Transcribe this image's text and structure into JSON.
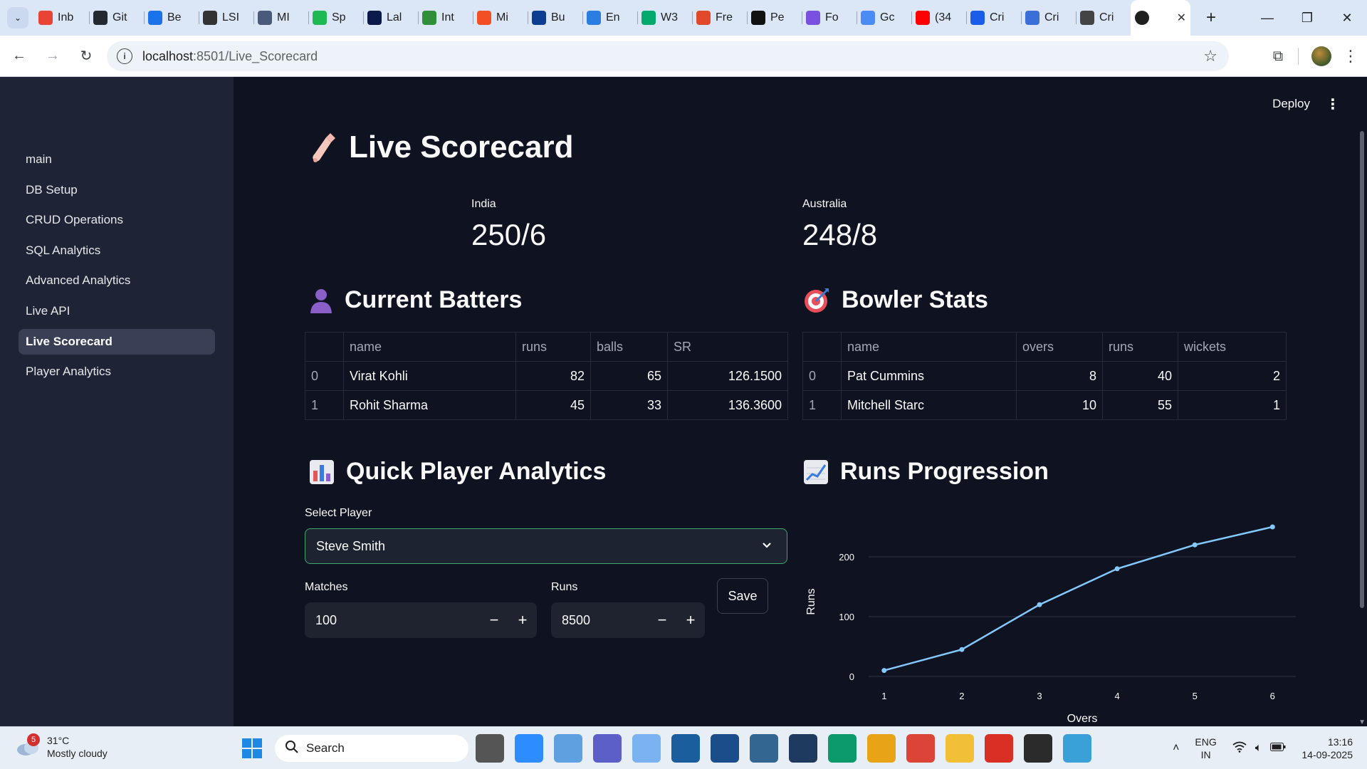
{
  "browser": {
    "tabs": [
      {
        "label": "Inb",
        "color": "#ea4335"
      },
      {
        "label": "Git",
        "color": "#24292f"
      },
      {
        "label": "Be",
        "color": "#1a73e8"
      },
      {
        "label": "LSI",
        "color": "#333333"
      },
      {
        "label": "MI",
        "color": "#4a5a7a"
      },
      {
        "label": "Sp",
        "color": "#1db954"
      },
      {
        "label": "Lal",
        "color": "#0a1a4a"
      },
      {
        "label": "Int",
        "color": "#2f8f3a"
      },
      {
        "label": "Mi",
        "color": "#f25022"
      },
      {
        "label": "Bu",
        "color": "#0b3d91"
      },
      {
        "label": "En",
        "color": "#2a7de1"
      },
      {
        "label": "W3",
        "color": "#04aa6d"
      },
      {
        "label": "Fre",
        "color": "#e04a2a"
      },
      {
        "label": "Pe",
        "color": "#111111"
      },
      {
        "label": "Fo",
        "color": "#7b4fe0"
      },
      {
        "label": "Gc",
        "color": "#4b8bf4"
      },
      {
        "label": "(34",
        "color": "#ff0000"
      },
      {
        "label": "Cri",
        "color": "#1a5de8"
      },
      {
        "label": "Cri",
        "color": "#3b6fd8"
      },
      {
        "label": "Cri",
        "color": "#444444"
      }
    ],
    "active_tab_close": "✕",
    "new_tab": "+",
    "url_host": "localhost",
    "url_path": ":8501/Live_Scorecard"
  },
  "sidebar": {
    "items": [
      {
        "label": "main"
      },
      {
        "label": "DB Setup"
      },
      {
        "label": "CRUD Operations"
      },
      {
        "label": "SQL Analytics"
      },
      {
        "label": "Advanced Analytics"
      },
      {
        "label": "Live API"
      },
      {
        "label": "Live Scorecard"
      },
      {
        "label": "Player Analytics"
      }
    ],
    "active_index": 6
  },
  "header": {
    "deploy_label": "Deploy",
    "menu_icon": "⋮"
  },
  "page": {
    "title": "Live Scorecard",
    "team1": {
      "name": "India",
      "score": "250/6"
    },
    "team2": {
      "name": "Australia",
      "score": "248/8"
    }
  },
  "batters": {
    "heading": "Current Batters",
    "columns": [
      "",
      "name",
      "runs",
      "balls",
      "SR"
    ],
    "rows": [
      {
        "idx": "0",
        "name": "Virat Kohli",
        "runs": "82",
        "balls": "65",
        "sr": "126.1500"
      },
      {
        "idx": "1",
        "name": "Rohit Sharma",
        "runs": "45",
        "balls": "33",
        "sr": "136.3600"
      }
    ]
  },
  "bowlers": {
    "heading": "Bowler Stats",
    "columns": [
      "",
      "name",
      "overs",
      "runs",
      "wickets"
    ],
    "rows": [
      {
        "idx": "0",
        "name": "Pat Cummins",
        "overs": "8",
        "runs": "40",
        "wickets": "2"
      },
      {
        "idx": "1",
        "name": "Mitchell Starc",
        "overs": "10",
        "runs": "55",
        "wickets": "1"
      }
    ]
  },
  "analytics": {
    "heading": "Quick Player Analytics",
    "select_label": "Select Player",
    "selected_player": "Steve Smith",
    "matches_label": "Matches",
    "matches_value": "100",
    "runs_label": "Runs",
    "runs_value": "8500",
    "minus": "−",
    "plus": "+",
    "save_label": "Save"
  },
  "progression": {
    "heading": "Runs Progression"
  },
  "chart_data": {
    "type": "line",
    "title": "",
    "xlabel": "Overs",
    "ylabel": "Runs",
    "x": [
      1,
      2,
      3,
      4,
      5,
      6
    ],
    "y": [
      10,
      45,
      120,
      180,
      220,
      250
    ],
    "xlim": [
      0.8,
      6.3
    ],
    "ylim": [
      0,
      250
    ],
    "yticks": [
      0,
      100,
      200
    ],
    "grid": true,
    "color": "#83c9ff"
  },
  "taskbar": {
    "weather_temp": "31°C",
    "weather_desc": "Mostly cloudy",
    "weather_badge": "5",
    "search_label": "Search",
    "lang_top": "ENG",
    "lang_bottom": "IN",
    "time": "13:16",
    "date": "14-09-2025"
  }
}
